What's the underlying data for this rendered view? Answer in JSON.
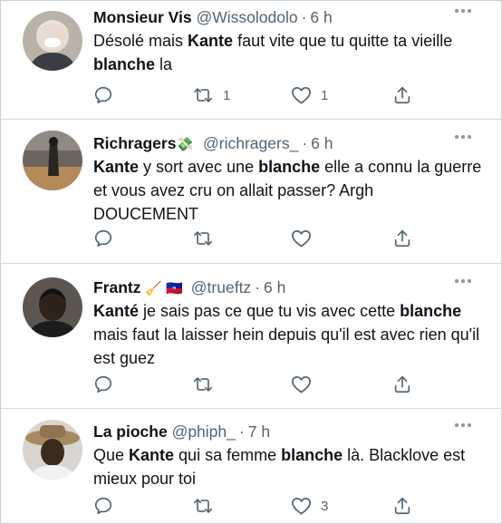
{
  "tweets": [
    {
      "name": "Monsieur Vis",
      "handle": "@Wissolodolo",
      "dot": "·",
      "time": "6 h",
      "text": [
        [
          "Désolé mais ",
          false
        ],
        [
          "Kante",
          true
        ],
        [
          " faut vite que tu quitte ta vieille ",
          false
        ],
        [
          "blanche",
          true
        ],
        [
          " la",
          false
        ]
      ],
      "reply_count": "",
      "retweet_count": "1",
      "like_count": "1"
    },
    {
      "name": "Richragers",
      "name_emoji": "💸",
      "handle": "@richragers_",
      "dot": "·",
      "time": "6 h",
      "text": [
        [
          "Kante",
          true
        ],
        [
          " y sort avec une ",
          false
        ],
        [
          "blanche",
          true
        ],
        [
          " elle a connu la guerre et vous avez cru on allait passer? Argh DOUCEMENT",
          false
        ]
      ],
      "reply_count": "",
      "retweet_count": "",
      "like_count": ""
    },
    {
      "name": "Frantz",
      "name_emoji": "🧹 🇭🇹",
      "handle": "@trueftz",
      "dot": "·",
      "time": "6 h",
      "text": [
        [
          "Kanté",
          true
        ],
        [
          " je sais pas ce que tu vis avec cette ",
          false
        ],
        [
          "blanche",
          true
        ],
        [
          " mais faut la laisser hein depuis qu'il est avec rien qu'il est guez",
          false
        ]
      ],
      "reply_count": "",
      "retweet_count": "",
      "like_count": ""
    },
    {
      "name": "La pioche",
      "handle": "@phiph_",
      "dot": "·",
      "time": "7 h",
      "text": [
        [
          "Que ",
          false
        ],
        [
          "Kante",
          true
        ],
        [
          " qui sa femme ",
          false
        ],
        [
          "blanche",
          true
        ],
        [
          " là. Blacklove est mieux pour toi",
          false
        ]
      ],
      "reply_count": "",
      "retweet_count": "",
      "like_count": "3"
    }
  ],
  "icons": {
    "reply": "reply-icon",
    "retweet": "retweet-icon",
    "like": "like-icon",
    "share": "share-icon",
    "more": "more-icon"
  },
  "colors": {
    "icon": "#536471",
    "separator": "#d6dce1"
  }
}
